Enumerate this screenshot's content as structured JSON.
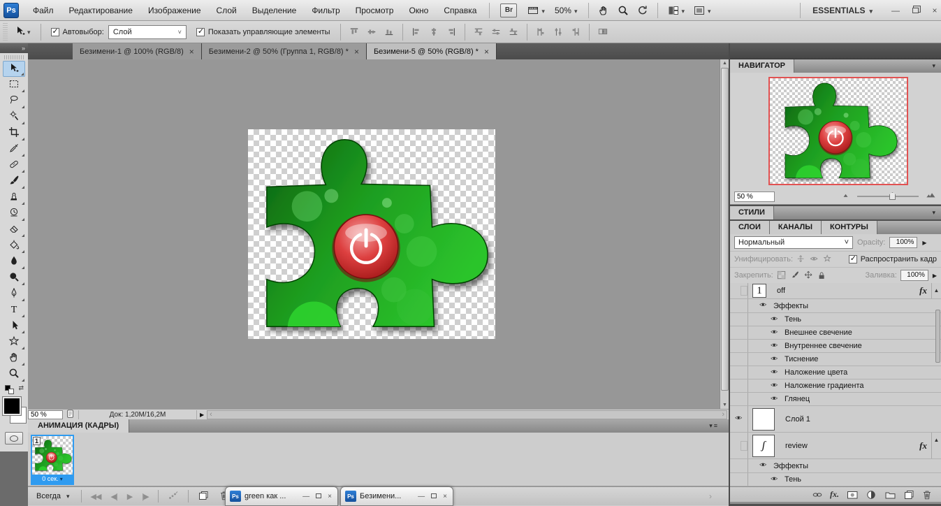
{
  "menubar": {
    "logo": "Ps",
    "items": [
      {
        "label": "Файл"
      },
      {
        "label": "Редактирование"
      },
      {
        "label": "Изображение"
      },
      {
        "label": "Слой"
      },
      {
        "label": "Выделение"
      },
      {
        "label": "Фильтр"
      },
      {
        "label": "Просмотр"
      },
      {
        "label": "Окно"
      },
      {
        "label": "Справка"
      }
    ],
    "bridge_label": "Br",
    "zoom_value": "50%",
    "workspace": "ESSENTIALS",
    "minimize_glyph": "—",
    "close_glyph": "×"
  },
  "options_bar": {
    "autoselect_label": "Автовыбор:",
    "autoselect_value": "Слой",
    "show_transform_label": "Показать управляющие элементы"
  },
  "document_tabs": [
    {
      "label": "Безимени-1 @ 100% (RGB/8)",
      "close": "×",
      "active": false
    },
    {
      "label": "Безимени-2 @ 50% (Группа 1, RGB/8) *",
      "close": "×",
      "active": false
    },
    {
      "label": "Безимени-5 @ 50% (RGB/8) *",
      "close": "×",
      "active": true
    }
  ],
  "toolbar": {
    "tools": [
      {
        "name": "move-tool",
        "icon": "move",
        "selected": true
      },
      {
        "name": "rectangular-marquee-tool",
        "icon": "marquee"
      },
      {
        "name": "lasso-tool",
        "icon": "lasso"
      },
      {
        "name": "quick-selection-tool",
        "icon": "quickselect"
      },
      {
        "name": "crop-tool",
        "icon": "crop"
      },
      {
        "name": "eyedropper-tool",
        "icon": "eyedropper"
      },
      {
        "name": "healing-brush-tool",
        "icon": "healing"
      },
      {
        "name": "brush-tool",
        "icon": "brush"
      },
      {
        "name": "clone-stamp-tool",
        "icon": "stamp"
      },
      {
        "name": "history-brush-tool",
        "icon": "history"
      },
      {
        "name": "eraser-tool",
        "icon": "eraser"
      },
      {
        "name": "paint-bucket-tool",
        "icon": "bucket"
      },
      {
        "name": "blur-tool",
        "icon": "blur"
      },
      {
        "name": "dodge-tool",
        "icon": "dodge"
      },
      {
        "name": "pen-tool",
        "icon": "pen"
      },
      {
        "name": "type-tool",
        "icon": "type"
      },
      {
        "name": "path-selection-tool",
        "icon": "pathselect"
      },
      {
        "name": "custom-shape-tool",
        "icon": "shape"
      },
      {
        "name": "hand-tool",
        "icon": "hand"
      },
      {
        "name": "zoom-tool",
        "icon": "zoomtool"
      }
    ]
  },
  "status_bar": {
    "zoom_value": "50 %",
    "doc_info": "Док: 1,20M/16,2M"
  },
  "navigator": {
    "title": "НАВИГАТОР",
    "zoom_value": "50 %"
  },
  "styles_panel": {
    "title": "СТИЛИ"
  },
  "layers_panel": {
    "tabs": [
      {
        "label": "СЛОИ",
        "active": true
      },
      {
        "label": "КАНАЛЫ",
        "active": false
      },
      {
        "label": "КОНТУРЫ",
        "active": false
      }
    ],
    "blend_mode": "Нормальный",
    "opacity_label": "Opacity:",
    "opacity_value": "100%",
    "unify_label": "Унифицировать:",
    "propagate_label": "Распространить кадр",
    "lock_label": "Закрепить:",
    "fill_label": "Заливка:",
    "fill_value": "100%",
    "fx_label": "fx",
    "rows": [
      {
        "name": "off",
        "layer": true,
        "small": true,
        "thumb": "one",
        "fx": true,
        "eye": false
      },
      {
        "name": "Эффекты",
        "fxheader": true,
        "eye": true
      },
      {
        "name": "Тень",
        "fxitem": true,
        "eye": true
      },
      {
        "name": "Внешнее свечение",
        "fxitem": true,
        "eye": true
      },
      {
        "name": "Внутреннее свечение",
        "fxitem": true,
        "eye": true
      },
      {
        "name": "Тиснение",
        "fxitem": true,
        "eye": true
      },
      {
        "name": "Наложение цвета",
        "fxitem": true,
        "eye": true
      },
      {
        "name": "Наложение градиента",
        "fxitem": true,
        "eye": true
      },
      {
        "name": "Глянец",
        "fxitem": true,
        "eye": true
      },
      {
        "name": "Слой 1",
        "layer": true,
        "thumb": "checker",
        "eye": true
      },
      {
        "name": "review",
        "layer": true,
        "thumb": "script",
        "fx": true,
        "eye": false
      },
      {
        "name": "Эффекты",
        "fxheader": true,
        "eye": true
      },
      {
        "name": "Тень",
        "fxitem": true,
        "eye": true
      }
    ]
  },
  "animation": {
    "title": "АНИМАЦИЯ (КАДРЫ)",
    "frame_number": "1",
    "frame_delay": "0 сек.",
    "loop_option": "Всегда"
  },
  "floating_windows": [
    {
      "title": "green как ..."
    },
    {
      "title": "Безимени..."
    }
  ],
  "colors": {
    "accent_blue": "#2f9bf0",
    "navigator_proxy_red": "#e25252",
    "puzzle_green": "#1e9e1e",
    "power_button_red": "#c42020"
  }
}
